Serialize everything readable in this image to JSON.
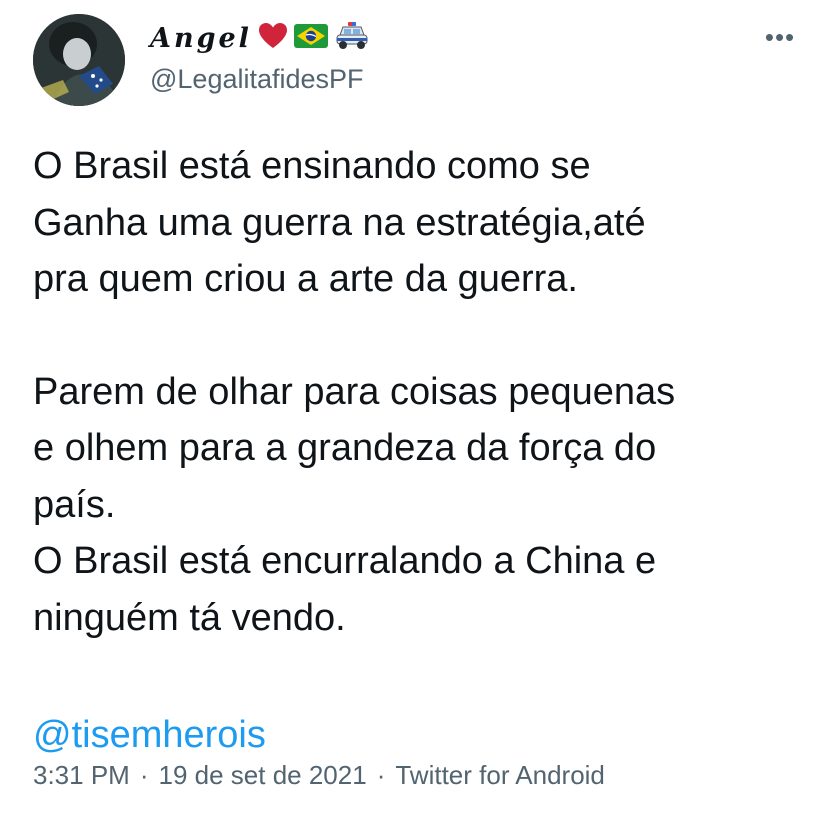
{
  "author": {
    "display_name": "Angel",
    "handle": "@LegalitafidesPF"
  },
  "tweet": {
    "paragraph_1": "O Brasil está ensinando como se\nGanha uma guerra na estratégia,até\npra quem criou a arte da guerra.",
    "paragraph_2": "Parem de olhar para coisas pequenas\ne olhem para a grandeza da força do\npaís.\nO Brasil está encurralando a China e\nninguém tá vendo.",
    "mention": "@tisemherois"
  },
  "meta": {
    "time": "3:31 PM",
    "separator": "·",
    "date": "19 de set de 2021",
    "source": "Twitter for Android"
  },
  "icons": {
    "more": "more-horizontal-icon",
    "heart": "red-heart-emoji",
    "flag": "brazil-flag-emoji",
    "car": "police-car-emoji"
  },
  "colors": {
    "text": "#0f1419",
    "secondary": "#536471",
    "link": "#1d9bf0",
    "heart": "#d0243a"
  }
}
